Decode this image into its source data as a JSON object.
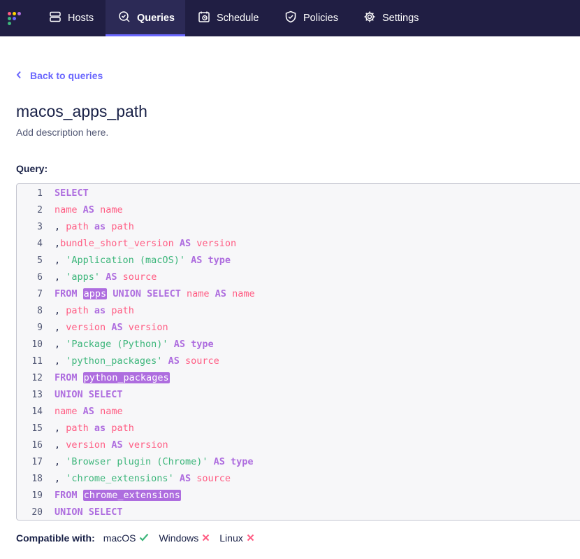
{
  "nav": {
    "items": [
      {
        "label": "Hosts",
        "icon": "hosts-icon"
      },
      {
        "label": "Queries",
        "icon": "queries-icon",
        "active": true
      },
      {
        "label": "Schedule",
        "icon": "schedule-icon"
      },
      {
        "label": "Policies",
        "icon": "policies-icon"
      },
      {
        "label": "Settings",
        "icon": "settings-icon"
      }
    ]
  },
  "back_link": "Back to queries",
  "query": {
    "name": "macos_apps_path",
    "description": "Add description here.",
    "label": "Query:"
  },
  "editor": {
    "lines": [
      [
        {
          "t": "SELECT",
          "c": "kw"
        }
      ],
      [
        {
          "t": "name",
          "c": "id"
        },
        {
          "t": " "
        },
        {
          "t": "AS",
          "c": "kw"
        },
        {
          "t": " "
        },
        {
          "t": "name",
          "c": "id"
        }
      ],
      [
        {
          "t": ", "
        },
        {
          "t": "path",
          "c": "id"
        },
        {
          "t": " "
        },
        {
          "t": "as",
          "c": "kw"
        },
        {
          "t": " "
        },
        {
          "t": "path",
          "c": "id"
        }
      ],
      [
        {
          "t": ","
        },
        {
          "t": "bundle_short_version",
          "c": "id"
        },
        {
          "t": " "
        },
        {
          "t": "AS",
          "c": "kw"
        },
        {
          "t": " "
        },
        {
          "t": "version",
          "c": "id"
        }
      ],
      [
        {
          "t": ", "
        },
        {
          "t": "'Application (macOS)'",
          "c": "st"
        },
        {
          "t": " "
        },
        {
          "t": "AS",
          "c": "kw"
        },
        {
          "t": " "
        },
        {
          "t": "type",
          "c": "kw"
        }
      ],
      [
        {
          "t": ", "
        },
        {
          "t": "'apps'",
          "c": "st"
        },
        {
          "t": " "
        },
        {
          "t": "AS",
          "c": "kw"
        },
        {
          "t": " "
        },
        {
          "t": "source",
          "c": "id"
        }
      ],
      [
        {
          "t": "FROM",
          "c": "kw"
        },
        {
          "t": " "
        },
        {
          "t": "apps",
          "c": "hl"
        },
        {
          "t": " "
        },
        {
          "t": "UNION",
          "c": "kw"
        },
        {
          "t": " "
        },
        {
          "t": "SELECT",
          "c": "kw"
        },
        {
          "t": " "
        },
        {
          "t": "name",
          "c": "id"
        },
        {
          "t": " "
        },
        {
          "t": "AS",
          "c": "kw"
        },
        {
          "t": " "
        },
        {
          "t": "name",
          "c": "id"
        }
      ],
      [
        {
          "t": ", "
        },
        {
          "t": "path",
          "c": "id"
        },
        {
          "t": " "
        },
        {
          "t": "as",
          "c": "kw"
        },
        {
          "t": " "
        },
        {
          "t": "path",
          "c": "id"
        }
      ],
      [
        {
          "t": ", "
        },
        {
          "t": "version",
          "c": "id"
        },
        {
          "t": " "
        },
        {
          "t": "AS",
          "c": "kw"
        },
        {
          "t": " "
        },
        {
          "t": "version",
          "c": "id"
        }
      ],
      [
        {
          "t": ", "
        },
        {
          "t": "'Package (Python)'",
          "c": "st"
        },
        {
          "t": " "
        },
        {
          "t": "AS",
          "c": "kw"
        },
        {
          "t": " "
        },
        {
          "t": "type",
          "c": "kw"
        }
      ],
      [
        {
          "t": ", "
        },
        {
          "t": "'python_packages'",
          "c": "st"
        },
        {
          "t": " "
        },
        {
          "t": "AS",
          "c": "kw"
        },
        {
          "t": " "
        },
        {
          "t": "source",
          "c": "id"
        }
      ],
      [
        {
          "t": "FROM",
          "c": "kw"
        },
        {
          "t": " "
        },
        {
          "t": "python_packages",
          "c": "hl"
        }
      ],
      [
        {
          "t": "UNION",
          "c": "kw"
        },
        {
          "t": " "
        },
        {
          "t": "SELECT",
          "c": "kw"
        }
      ],
      [
        {
          "t": "name",
          "c": "id"
        },
        {
          "t": " "
        },
        {
          "t": "AS",
          "c": "kw"
        },
        {
          "t": " "
        },
        {
          "t": "name",
          "c": "id"
        }
      ],
      [
        {
          "t": ", "
        },
        {
          "t": "path",
          "c": "id"
        },
        {
          "t": " "
        },
        {
          "t": "as",
          "c": "kw"
        },
        {
          "t": " "
        },
        {
          "t": "path",
          "c": "id"
        }
      ],
      [
        {
          "t": ", "
        },
        {
          "t": "version",
          "c": "id"
        },
        {
          "t": " "
        },
        {
          "t": "AS",
          "c": "kw"
        },
        {
          "t": " "
        },
        {
          "t": "version",
          "c": "id"
        }
      ],
      [
        {
          "t": ", "
        },
        {
          "t": "'Browser plugin (Chrome)'",
          "c": "st"
        },
        {
          "t": " "
        },
        {
          "t": "AS",
          "c": "kw"
        },
        {
          "t": " "
        },
        {
          "t": "type",
          "c": "kw"
        }
      ],
      [
        {
          "t": ", "
        },
        {
          "t": "'chrome_extensions'",
          "c": "st"
        },
        {
          "t": " "
        },
        {
          "t": "AS",
          "c": "kw"
        },
        {
          "t": " "
        },
        {
          "t": "source",
          "c": "id"
        }
      ],
      [
        {
          "t": "FROM",
          "c": "kw"
        },
        {
          "t": " "
        },
        {
          "t": "chrome_extensions",
          "c": "hl"
        }
      ],
      [
        {
          "t": "UNION",
          "c": "kw"
        },
        {
          "t": " "
        },
        {
          "t": "SELECT",
          "c": "kw"
        }
      ]
    ]
  },
  "compat": {
    "label": "Compatible with:",
    "platforms": [
      {
        "name": "macOS",
        "compatible": true
      },
      {
        "name": "Windows",
        "compatible": false
      },
      {
        "name": "Linux",
        "compatible": false
      }
    ]
  },
  "colors": {
    "nav_bg": "#201e43",
    "accent": "#6a67fe",
    "keyword": "#ae6ddf",
    "identifier": "#ff5c83",
    "string": "#3db67b",
    "check": "#3db67b",
    "cross": "#ff5c83"
  }
}
